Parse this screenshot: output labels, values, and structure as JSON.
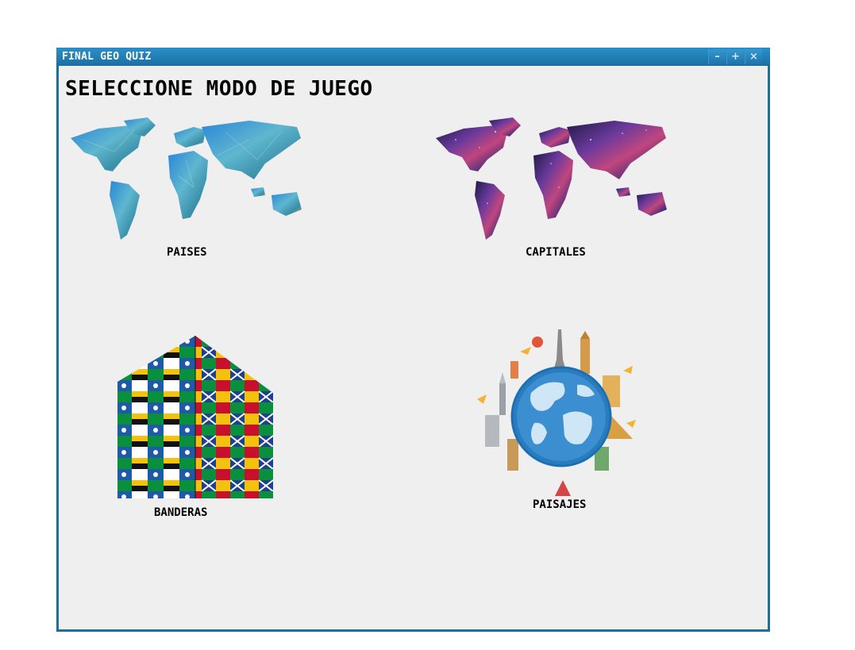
{
  "window": {
    "title": "FINAL GEO QUIZ",
    "controls": {
      "minimize": "–",
      "maximize": "+",
      "close": "×"
    }
  },
  "main": {
    "heading": "SELECCIONE MODO DE JUEGO",
    "modes": [
      {
        "label": "PAISES",
        "icon": "world-map-polygon-icon"
      },
      {
        "label": "CAPITALES",
        "icon": "world-map-galaxy-icon"
      },
      {
        "label": "BANDERAS",
        "icon": "flags-cube-icon"
      },
      {
        "label": "PAISAJES",
        "icon": "globe-landmarks-icon"
      }
    ]
  },
  "colors": {
    "titlebar": "#1a6fa3",
    "client_background": "#efefef",
    "border": "#1d6f98"
  }
}
